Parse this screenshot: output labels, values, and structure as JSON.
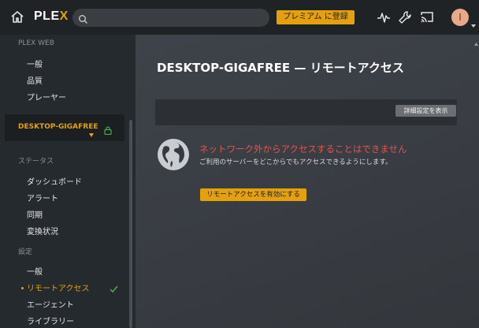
{
  "topbar": {
    "logo_text": "PLE",
    "logo_x": "X",
    "search_placeholder": "",
    "premium_label": "プレミアム に登録",
    "avatar_initial": "I",
    "icons": [
      "home-icon",
      "activity-icon",
      "wrench-icon",
      "cast-icon"
    ]
  },
  "sidebar": {
    "section_web": "PLEX WEB",
    "web_items": [
      "一般",
      "品質",
      "プレーヤー"
    ],
    "server_name": "DESKTOP-GIGAFREE",
    "section_status": "ステータス",
    "status_items": [
      "ダッシュボード",
      "アラート",
      "同期",
      "変換状況"
    ],
    "section_settings": "設定",
    "settings_items": [
      "一般",
      "リモートアクセス",
      "エージェント",
      "ライブラリー"
    ],
    "active_item": "リモートアクセス"
  },
  "main": {
    "title": "DESKTOP-GIGAFREE — リモートアクセス",
    "advanced_label": "詳細設定を表示",
    "status_title": "ネットワーク外からアクセスすることはできません",
    "status_desc": "ご利用のサーバーをどこからでもアクセスできるようにします。",
    "enable_label": "リモートアクセスを有効にする"
  },
  "colors": {
    "accent": "#e5a00d",
    "error": "#e5534b",
    "topbar": "#1f2326",
    "sidebar": "#252a2f"
  }
}
